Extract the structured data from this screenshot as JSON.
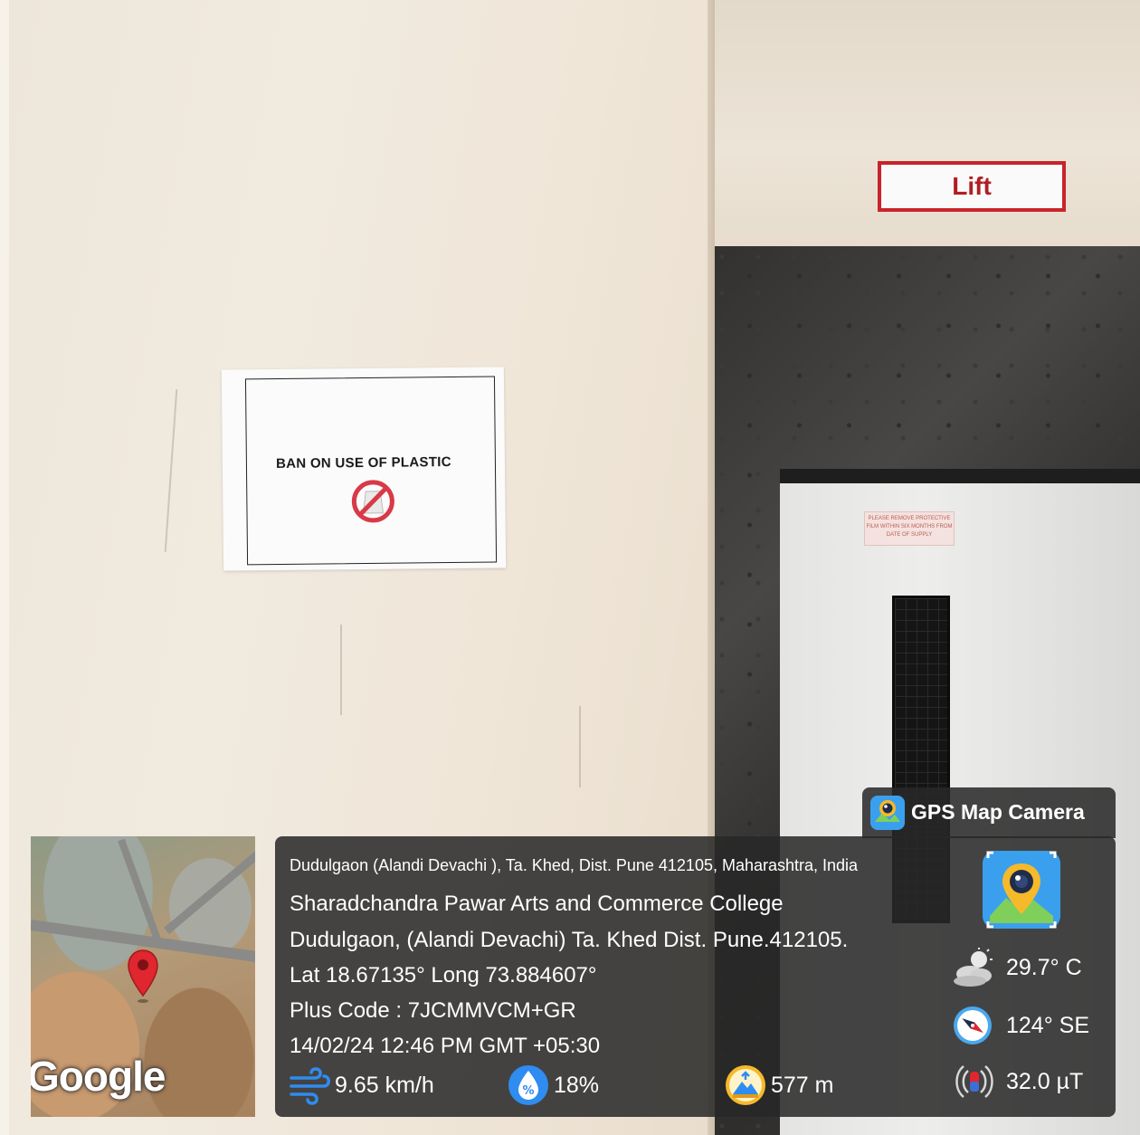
{
  "scene": {
    "poster_text": "BAN ON USE OF PLASTIC",
    "lift_sign": "Lift",
    "door_sticker": "PLEASE REMOVE PROTECTIVE FILM WITHIN SIX MONTHS FROM DATE OF SUPPLY"
  },
  "map": {
    "provider_logo": "Google"
  },
  "overlay": {
    "app_name": "GPS Map Camera",
    "address": "Dudulgaon (Alandi Devachi ), Ta. Khed, Dist. Pune 412105, Maharashtra, India",
    "place_line1": "Sharadchandra Pawar Arts and Commerce College",
    "place_line2": "Dudulgaon, (Alandi Devachi) Ta. Khed Dist. Pune.412105.",
    "coordinates": "Lat 18.67135° Long 73.884607°",
    "plus_code": "Plus Code : 7JCMMVCM+GR",
    "datetime": "14/02/24 12:46 PM GMT +05:30",
    "wind": "9.65 km/h",
    "humidity": "18%",
    "altitude": "577 m",
    "temperature": "29.7° C",
    "compass": "124° SE",
    "magnetic": "32.0 µT"
  },
  "colors": {
    "panel": "#282828",
    "sign_red": "#c8242b",
    "app_blue": "#3a8ee6",
    "wind_blue": "#2f8cf0"
  }
}
